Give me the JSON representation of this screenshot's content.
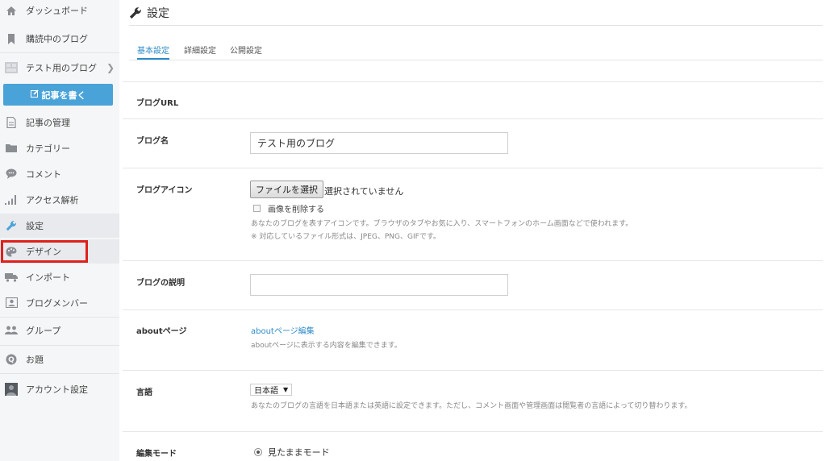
{
  "sidebar": {
    "items": [
      {
        "label": "ダッシュボード",
        "icon": "home-icon"
      },
      {
        "label": "購読中のブログ",
        "icon": "bookmark-icon"
      },
      {
        "label": "テスト用のブログ",
        "icon": "blog-thumbnail-icon"
      },
      {
        "label": "記事の管理",
        "icon": "document-icon"
      },
      {
        "label": "カテゴリー",
        "icon": "folder-icon"
      },
      {
        "label": "コメント",
        "icon": "comment-icon"
      },
      {
        "label": "アクセス解析",
        "icon": "bar-signal-icon"
      },
      {
        "label": "設定",
        "icon": "wrench-icon"
      },
      {
        "label": "デザイン",
        "icon": "palette-icon"
      },
      {
        "label": "インポート",
        "icon": "truck-icon"
      },
      {
        "label": "ブログメンバー",
        "icon": "id-card-icon"
      },
      {
        "label": "グループ",
        "icon": "group-icon"
      },
      {
        "label": "お題",
        "icon": "q-icon"
      },
      {
        "label": "アカウント設定",
        "icon": "user-avatar-icon"
      }
    ],
    "write_button": "記事を書く"
  },
  "header": {
    "title": "設定"
  },
  "tabs": [
    "基本設定",
    "詳細設定",
    "公開設定"
  ],
  "form": {
    "blog_url": {
      "label": "ブログURL"
    },
    "blog_name": {
      "label": "ブログ名",
      "value": "テスト用のブログ"
    },
    "blog_icon": {
      "label": "ブログアイコン",
      "file_button": "ファイルを選択",
      "file_status": "選択されていません",
      "delete_label": "画像を削除する",
      "help1": "あなたのブログを表すアイコンです。ブラウザのタブやお気に入り、スマートフォンのホーム画面などで使われます。",
      "help2": "※ 対応しているファイル形式は、JPEG、PNG、GIFです。"
    },
    "blog_description": {
      "label": "ブログの説明",
      "value": ""
    },
    "about": {
      "label": "aboutページ",
      "link": "aboutページ編集",
      "help": "aboutページに表示する内容を編集できます。"
    },
    "language": {
      "label": "言語",
      "value": "日本語",
      "help": "あなたのブログの言語を日本語または英語に設定できます。ただし、コメント画面や管理画面は閲覧者の言語によって切り替わります。"
    },
    "edit_mode": {
      "label": "編集モード",
      "option": "見たままモード"
    }
  },
  "colors": {
    "accent": "#4aa3d8",
    "link": "#2d8ac8",
    "highlight": "#e0201b",
    "sidebar_bg": "#f5f6f7"
  }
}
